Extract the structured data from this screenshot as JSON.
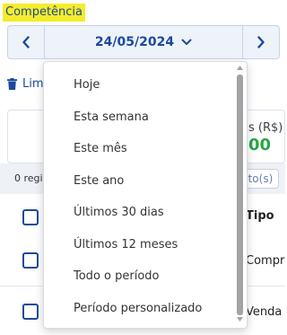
{
  "competencia": {
    "label": "Competência"
  },
  "date_selector": {
    "value": "24/05/2024",
    "prev_icon": "chevron-left-icon",
    "next_icon": "chevron-right-icon",
    "toggle_icon": "chevron-down-icon"
  },
  "toolbar": {
    "clear_label": "Lim",
    "clear_icon": "trash-icon"
  },
  "summary_card": {
    "column_header": "s (R$)",
    "value": "00"
  },
  "info_bar": {
    "count_text": "0 regis",
    "pill_text": "nto(s)"
  },
  "table": {
    "header_tipo": "Tipo",
    "rows": [
      {
        "tipo": "Compra"
      },
      {
        "tipo": "Venda"
      }
    ]
  },
  "period_dropdown": {
    "options": [
      "Hoje",
      "Esta semana",
      "Este mês",
      "Este ano",
      "Últimos 30 dias",
      "Últimos 12 meses",
      "Todo o período",
      "Período personalizado"
    ]
  },
  "colors": {
    "accent": "#1b4a9b",
    "highlight": "#f5ec2a",
    "positive": "#27a745"
  }
}
